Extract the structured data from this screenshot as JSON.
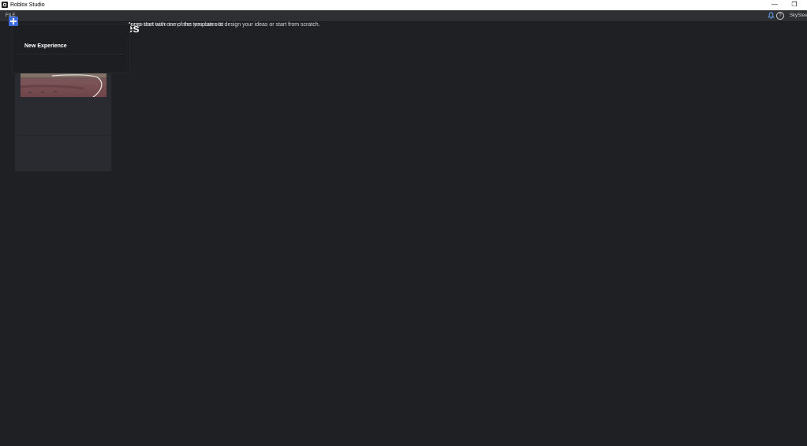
{
  "window": {
    "title": "Roblox Studio",
    "minimize_glyph": "—",
    "restore_glyph": "❐"
  },
  "menubar": {
    "file_label": "FILE",
    "user_label": "SkySteel"
  },
  "main": {
    "heading": "es",
    "subtext_ghost": "ences that have templates you can edit",
    "subtext": "Jump-start with one of the templates to design your ideas or start from scratch."
  },
  "popup": {
    "new_experience_label": "New Experience"
  },
  "icons": {
    "app": "roblox-studio-icon",
    "bell": "notification-bell-icon",
    "help": "help-icon",
    "plus": "plus-icon"
  },
  "colors": {
    "accent": "#3d6bdc",
    "background": "#1f2024",
    "card": "#2a2b30"
  }
}
